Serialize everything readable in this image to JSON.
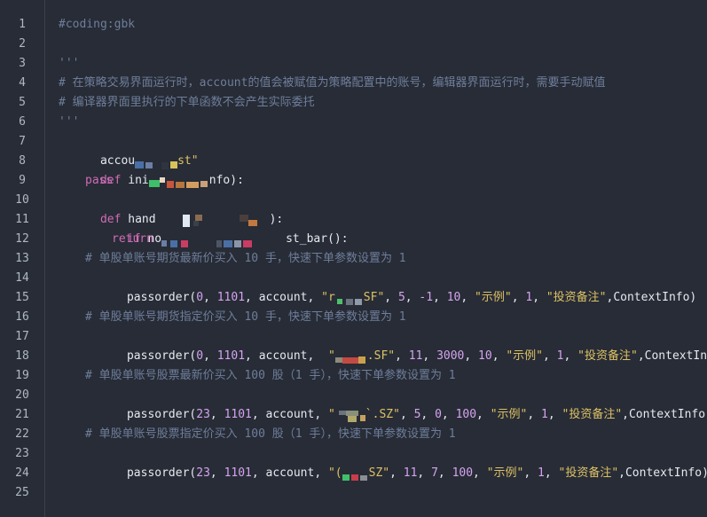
{
  "editor": {
    "line_numbers": [
      "1",
      "2",
      "3",
      "4",
      "5",
      "6",
      "7",
      "8",
      "9",
      "10",
      "11",
      "12",
      "13",
      "14",
      "15",
      "16",
      "17",
      "18",
      "19",
      "20",
      "21",
      "22",
      "23",
      "24",
      "25"
    ],
    "lines": {
      "l1": "#coding:gbk",
      "l3": "'''",
      "l4": "# 在策略交易界面运行时，account的值会被赋值为策略配置中的账号，编辑器界面运行时，需要手动赋值",
      "l5": "# 编译器界面里执行的下单函数不会产生实际委托",
      "l6": "'''",
      "l7_a": "accou",
      "l7_b": "st\"",
      "l8_kw": "def",
      "l8_a": "ini",
      "l8_b": "nfo):",
      "l9": "pass",
      "l10_kw": "def",
      "l10_a": "hand",
      "l10_b": "):",
      "l11_kw": "if",
      "l11_a": "no",
      "l11_b": "st_bar():",
      "l12": "return",
      "l13": "# 单股单账号期货最新价买入 10 手，快速下单参数设置为 1",
      "l14": {
        "a": "passorder(",
        "n1": "0",
        "c1": ", ",
        "n2": "1101",
        "c2": ", account, ",
        "s1a": "\"r",
        "s1b": "SF\"",
        "c3": ", ",
        "n3": "5",
        "c4": ", ",
        "n4": "-1",
        "c5": ", ",
        "n5": "10",
        "c6": ", ",
        "s2": "\"示例\"",
        "c7": ", ",
        "n6": "1",
        "c8": ", ",
        "s3": "\"投资备注\"",
        "tail": ",ContextInfo)"
      },
      "l16": "# 单股单账号期货指定价买入 10 手，快速下单参数设置为 1",
      "l17": {
        "a": "passorder(",
        "n1": "0",
        "c1": ", ",
        "n2": "1101",
        "c2": ", account, ",
        "s1a": " \"",
        "s1b": ".SF\"",
        "c3": ", ",
        "n3": "11",
        "c4": ", ",
        "n4": "3000",
        "c5": ", ",
        "n5": "10",
        "c6": ", ",
        "s2": "\"示例\"",
        "c7": ", ",
        "n6": "1",
        "c8": ", ",
        "s3": "\"投资备注\"",
        "tail": ",ContextInfo)"
      },
      "l19": "# 单股单账号股票最新价买入 100 股（1 手），快速下单参数设置为 1",
      "l20": {
        "a": "passorder(",
        "n1": "23",
        "c1": ", ",
        "n2": "1101",
        "c2": ", account, ",
        "s1a": "\"",
        "s1b": "`.SZ\"",
        "c3": ", ",
        "n3": "5",
        "c4": ", ",
        "n4": "0",
        "c5": ", ",
        "n5": "100",
        "c6": ", ",
        "s2": "\"示例\"",
        "c7": ", ",
        "n6": "1",
        "c8": ", ",
        "s3": "\"投资备注\"",
        "tail": ",ContextInfo)"
      },
      "l22": "# 单股单账号股票指定价买入 100 股（1 手），快速下单参数设置为 1",
      "l23": {
        "a": "passorder(",
        "n1": "23",
        "c1": ", ",
        "n2": "1101",
        "c2": ", account, ",
        "s1a": "\"(",
        "s1b": "SZ\"",
        "c3": ", ",
        "n3": "11",
        "c4": ", ",
        "n4": "7",
        "c5": ", ",
        "n5": "100",
        "c6": ", ",
        "s2": "\"示例\"",
        "c7": ", ",
        "n6": "1",
        "c8": ", ",
        "s3": "\"投资备注\"",
        "tail": ",ContextInfo)"
      }
    }
  },
  "colors": {
    "background": "#272c36",
    "comment": "#6f7e9b",
    "keyword": "#d06bb5",
    "string": "#dec165",
    "number": "#d6a3f0",
    "text": "#e6e9ef"
  }
}
